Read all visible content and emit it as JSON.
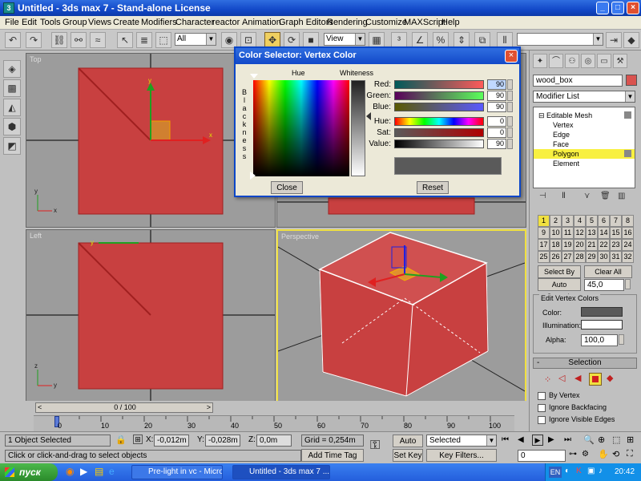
{
  "window": {
    "title": "Untitled - 3ds max 7   - Stand-alone License",
    "icon": "3ds-max-icon",
    "buttons": [
      "minimize",
      "maximize",
      "close"
    ]
  },
  "menu": [
    "File",
    "Edit",
    "Tools",
    "Group",
    "Views",
    "Create",
    "Modifiers",
    "Character",
    "reactor",
    "Animation",
    "Graph Editors",
    "Rendering",
    "Customize",
    "MAXScript",
    "Help"
  ],
  "toolbar": {
    "selection_filter": "All",
    "ref_coord": "View",
    "named_selection": ""
  },
  "viewports": {
    "top": "Top",
    "left": "Left",
    "front": "",
    "perspective": "Perspective"
  },
  "axes": {
    "x": "x",
    "y": "y",
    "z": "z"
  },
  "color_dialog": {
    "title": "Color Selector: Vertex Color",
    "hue_label": "Hue",
    "whiteness_label": "Whiteness",
    "blackness_letters": [
      "B",
      "l",
      "a",
      "c",
      "k",
      "n",
      "e",
      "s",
      "s"
    ],
    "channels": [
      {
        "label": "Red:",
        "value": "90"
      },
      {
        "label": "Green:",
        "value": "90"
      },
      {
        "label": "Blue:",
        "value": "90"
      },
      {
        "label": "Hue:",
        "value": "0"
      },
      {
        "label": "Sat:",
        "value": "0"
      },
      {
        "label": "Value:",
        "value": "90"
      }
    ],
    "swatch_color": "#5a5a5a",
    "close": "Close",
    "reset": "Reset"
  },
  "command_panel": {
    "object_name": "wood_box",
    "modifier_list": "Modifier List",
    "stack": [
      {
        "label": "Editable Mesh",
        "level": 0,
        "selected": false
      },
      {
        "label": "Vertex",
        "level": 1,
        "selected": false
      },
      {
        "label": "Edge",
        "level": 1,
        "selected": false
      },
      {
        "label": "Face",
        "level": 1,
        "selected": false
      },
      {
        "label": "Polygon",
        "level": 1,
        "selected": true
      },
      {
        "label": "Element",
        "level": 1,
        "selected": false
      }
    ],
    "smoothing_groups": [
      "1",
      "2",
      "3",
      "4",
      "5",
      "6",
      "7",
      "8",
      "9",
      "10",
      "11",
      "12",
      "13",
      "14",
      "15",
      "16",
      "17",
      "18",
      "19",
      "20",
      "21",
      "22",
      "23",
      "24",
      "25",
      "26",
      "27",
      "28",
      "29",
      "30",
      "31",
      "32"
    ],
    "select_by_sg": "Select By SG",
    "clear_all": "Clear All",
    "auto_smooth": "Auto Smooth",
    "auto_smooth_value": "45,0",
    "edit_vertex_colors": "Edit Vertex Colors",
    "color_label": "Color:",
    "illumination_label": "Illumination:",
    "alpha_label": "Alpha:",
    "alpha_value": "100,0",
    "selection_rollout": "Selection",
    "by_vertex": "By Vertex",
    "ignore_backfacing": "Ignore Backfacing",
    "ignore_visible_edges": "Ignore Visible Edges"
  },
  "timeline": {
    "frame": "0 / 100",
    "ticks": [
      "0",
      "10",
      "20",
      "30",
      "40",
      "50",
      "60",
      "70",
      "80",
      "90",
      "100"
    ]
  },
  "status": {
    "selected": "1 Object Selected",
    "prompt": "Click or click-and-drag to select objects",
    "x_label": "X:",
    "x_value": "-0,012m",
    "y_label": "Y:",
    "y_value": "-0,028m",
    "z_label": "Z:",
    "z_value": "0,0m",
    "grid": "Grid = 0,254m",
    "add_time_tag": "Add Time Tag",
    "auto_key": "Auto Key",
    "set_key": "Set Key",
    "selected_combo": "Selected",
    "key_filters": "Key Filters...",
    "frame_field": "0"
  },
  "taskbar": {
    "start": "пуск",
    "tasks": [
      "Pre-light in vc - Micro...",
      "Untitled - 3ds max 7 ..."
    ],
    "lang": "EN",
    "time": "20:42"
  },
  "colors": {
    "object_red": "#c84040",
    "titlebar_blue": "#1248c8",
    "active_viewport": "#f0e040"
  }
}
